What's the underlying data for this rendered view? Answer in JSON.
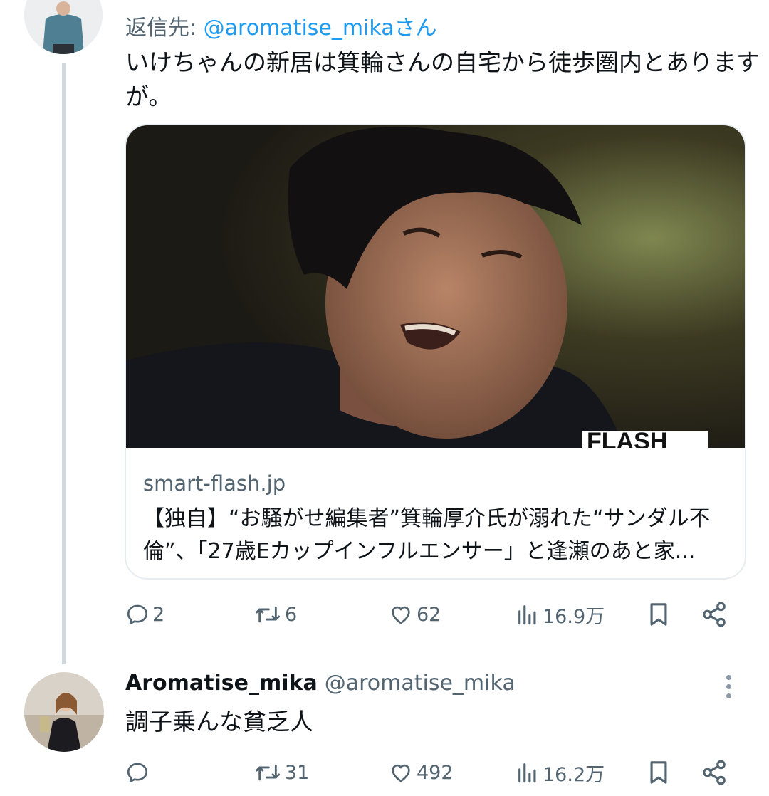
{
  "reply_tweet": {
    "reply_prefix": "返信先: ",
    "reply_handle": "@aromatise_mikaさん",
    "text_line1": "いけちゃんの新居は箕輪さんの自宅から徒歩圏内とあります",
    "text_line2": "が。",
    "card": {
      "watermark": "FLASH",
      "domain": "smart-flash.jp",
      "title_line1": "【独自】“お騒がせ編集者”箕輪厚介氏が溺れた“サンダル不",
      "title_line2": "倫”、「27歳Eカップインフルエンサー」と逢瀬のあと家..."
    },
    "actions": {
      "replies": "2",
      "reposts": "6",
      "likes": "62",
      "views": "16.9万"
    }
  },
  "main_tweet": {
    "display_name": "Aromatise_mika",
    "handle": "@aromatise_mika",
    "text": "調子乗んな貧乏人",
    "actions": {
      "replies": "",
      "reposts": "31",
      "likes": "492",
      "views": "16.2万"
    }
  },
  "icons": [
    "reply-icon",
    "repost-icon",
    "like-icon",
    "views-icon",
    "bookmark-icon",
    "share-icon",
    "more-icon"
  ],
  "colors": {
    "link": "#1d9bf0",
    "secondary": "#536471",
    "text": "#0f1419",
    "thread_line": "#cfd9de"
  }
}
